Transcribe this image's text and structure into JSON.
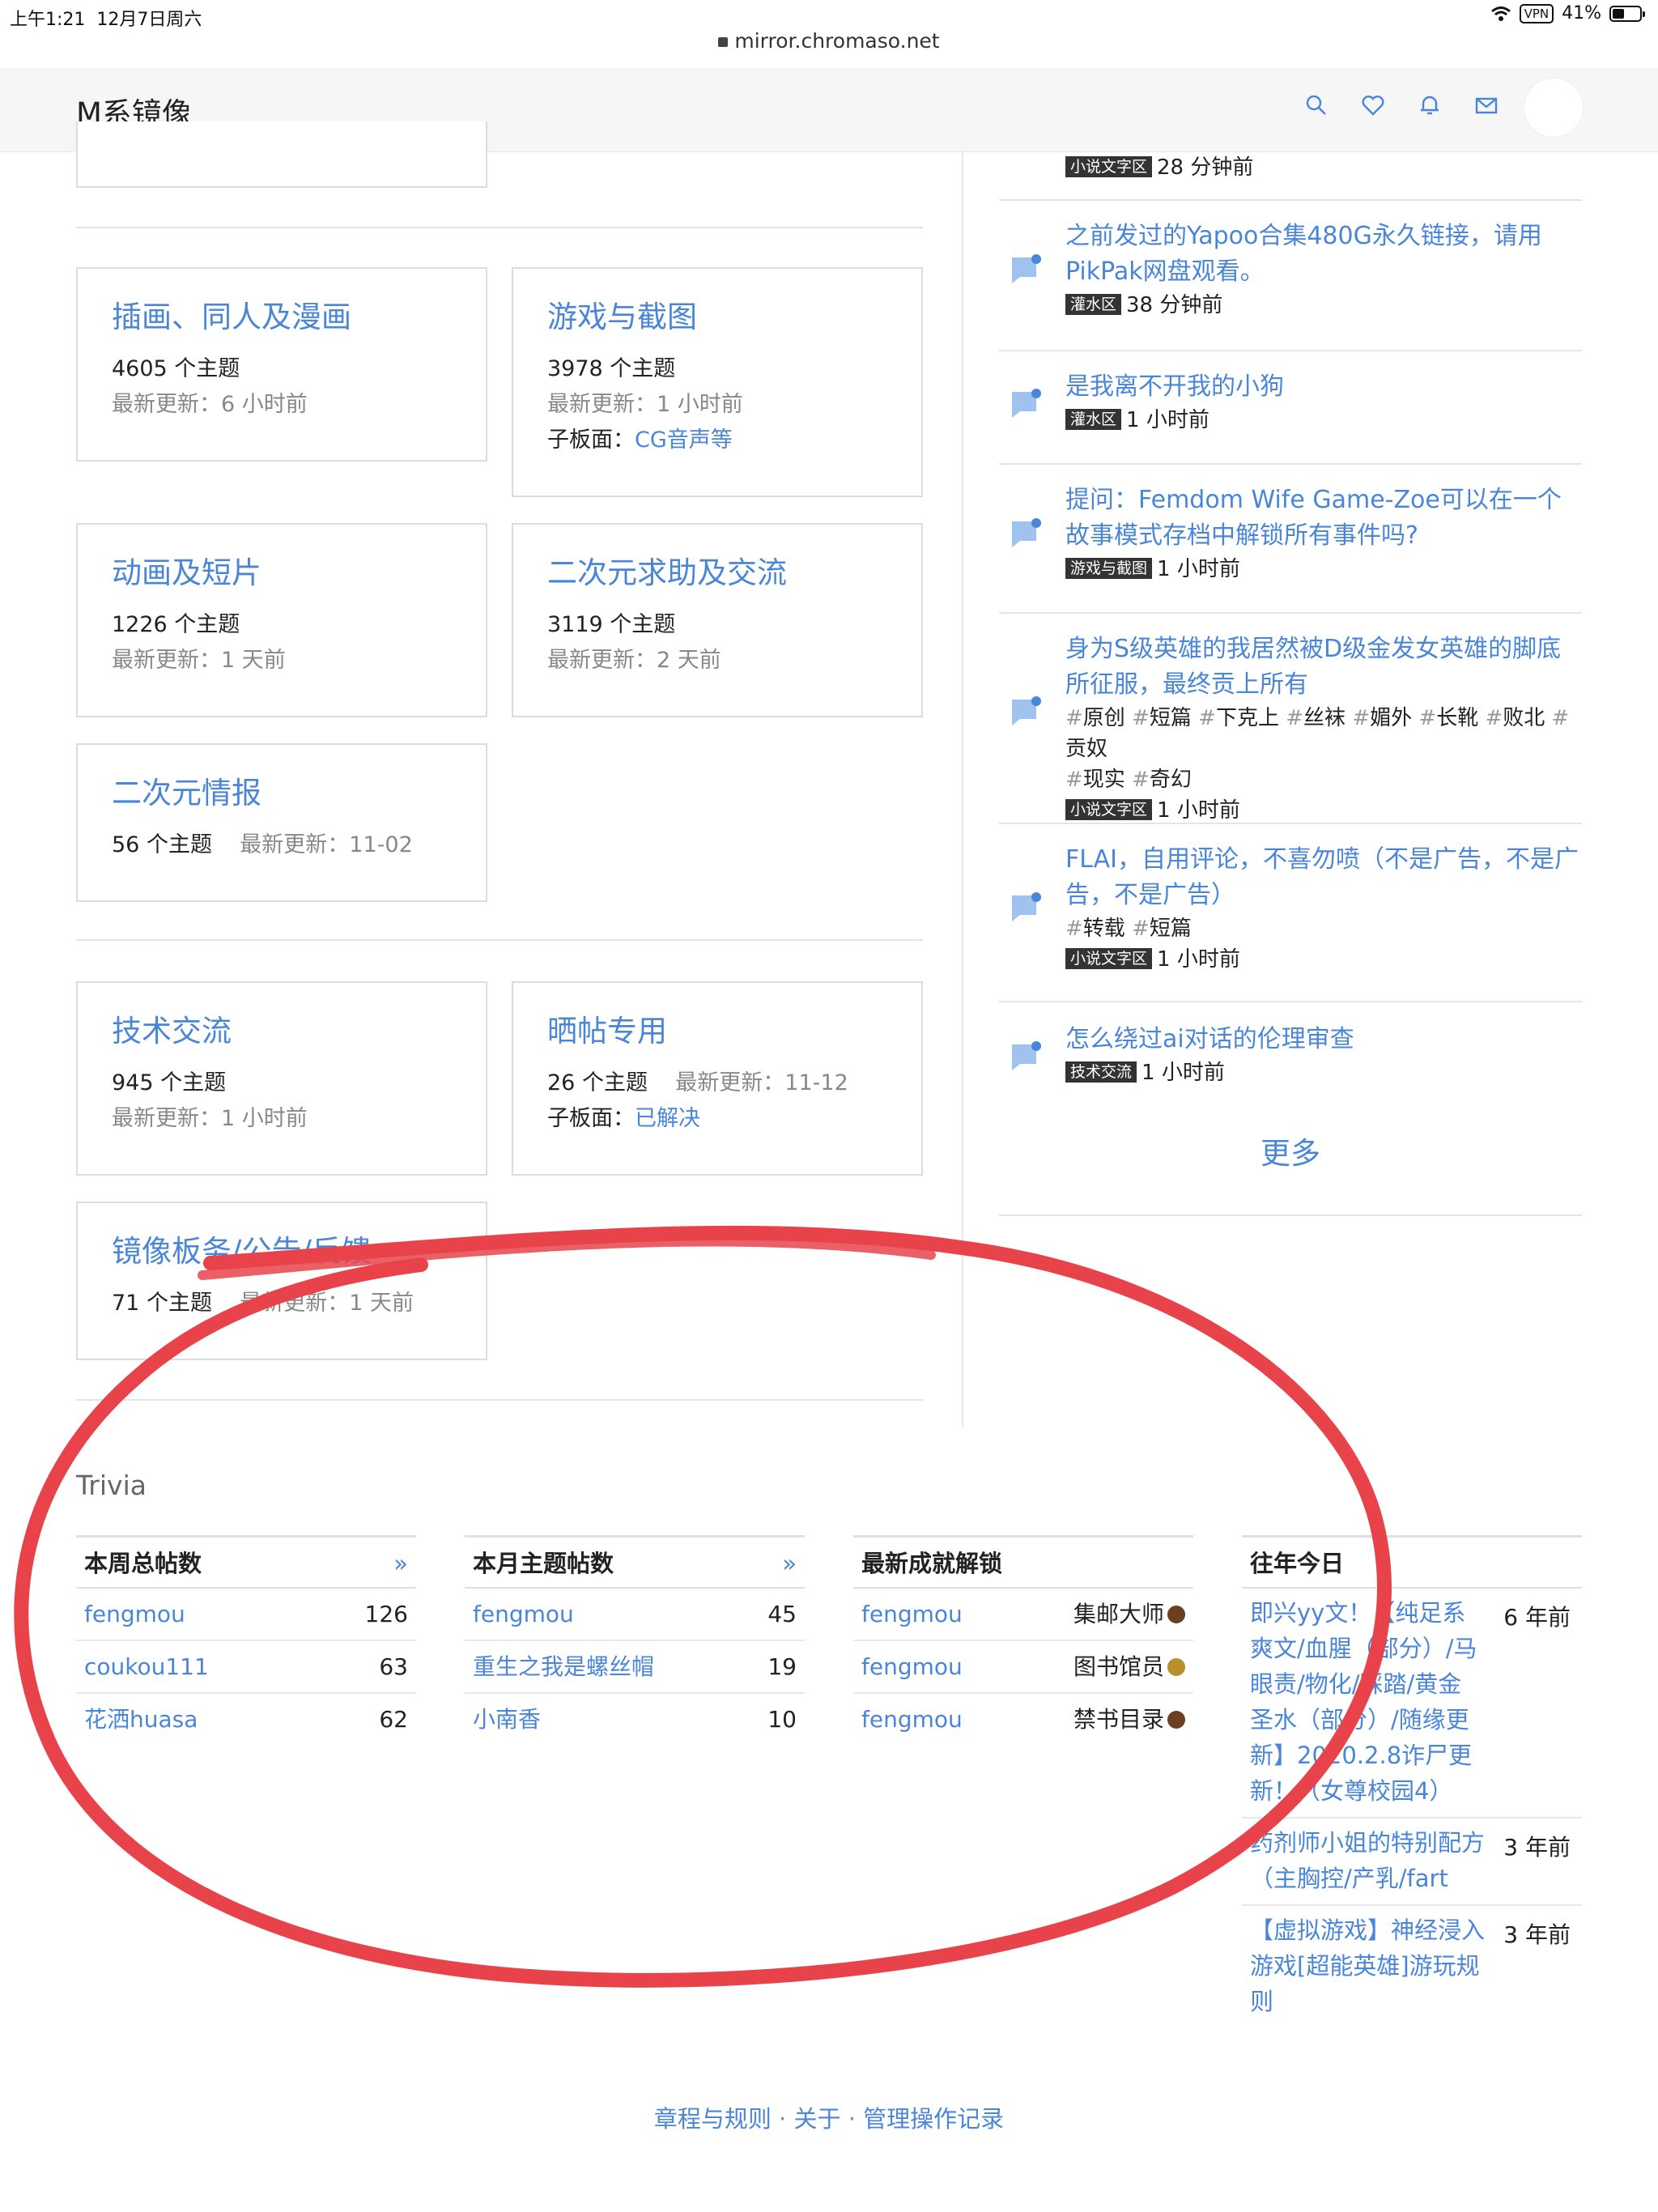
{
  "status": {
    "time": "上午1:21",
    "date": "12月7日周六",
    "vpn": "VPN",
    "battery": "41%"
  },
  "url": "mirror.chromaso.net",
  "nav": {
    "brand": "M系镜像"
  },
  "forums": [
    {
      "title": "插画、同人及漫画",
      "topics": "4605 个主题",
      "updated_label": "最新更新：",
      "updated": "6 小时前"
    },
    {
      "title": "游戏与截图",
      "topics": "3978 个主题",
      "updated_label": "最新更新：",
      "updated": "1 小时前",
      "sub_label": "子板面：",
      "sub": "CG音声等"
    },
    {
      "title": "动画及短片",
      "topics": "1226 个主题",
      "updated_label": "最新更新：",
      "updated": "1 天前"
    },
    {
      "title": "二次元求助及交流",
      "topics": "3119 个主题",
      "updated_label": "最新更新：",
      "updated": "2 天前"
    },
    {
      "title": "二次元情报",
      "topics": "56 个主题",
      "updated_label": "最新更新：",
      "updated": "11-02"
    },
    {
      "title": "技术交流",
      "topics": "945 个主题",
      "updated_label": "最新更新：",
      "updated": "1 小时前"
    },
    {
      "title": "晒帖专用",
      "topics": "26 个主题",
      "updated_label": "最新更新：",
      "updated": "11-12",
      "sub_label": "子板面：",
      "sub": "已解决"
    },
    {
      "title": "镜像板务/公告/反馈",
      "topics": "71 个主题",
      "updated_label": "最新更新：",
      "updated": "1 天前"
    }
  ],
  "posts": [
    {
      "badge": "小说文字区",
      "time": "28 分钟前"
    },
    {
      "title": "之前发过的Yapoo合集480G永久链接，请用PikPak网盘观看。",
      "badge": "灌水区",
      "time": "38 分钟前"
    },
    {
      "title": "是我离不开我的小狗",
      "badge": "灌水区",
      "time": "1 小时前"
    },
    {
      "title": "提问：Femdom Wife Game-Zoe可以在一个故事模式存档中解锁所有事件吗?",
      "badge": "游戏与截图",
      "time": "1 小时前"
    },
    {
      "title": "身为S级英雄的我居然被D级金发女英雄的脚底所征服，最终贡上所有",
      "tags": [
        "原创",
        "短篇",
        "下克上",
        "丝袜",
        "媚外",
        "长靴",
        "败北",
        "贡奴",
        "现实",
        "奇幻"
      ],
      "badge": "小说文字区",
      "time": "1 小时前"
    },
    {
      "title": "FLAI，自用评论，不喜勿喷（不是广告，不是广告，不是广告）",
      "tags": [
        "转载",
        "短篇"
      ],
      "badge": "小说文字区",
      "time": "1 小时前"
    },
    {
      "title": "怎么绕过ai对话的伦理审查",
      "badge": "技术交流",
      "time": "1 小时前"
    }
  ],
  "more": "更多",
  "trivia": {
    "title": "Trivia",
    "weekly": {
      "header": "本周总帖数",
      "more": "»",
      "rows": [
        {
          "name": "fengmou",
          "value": "126"
        },
        {
          "name": "coukou111",
          "value": "63"
        },
        {
          "name": "花洒huasa",
          "value": "62"
        }
      ]
    },
    "monthly": {
      "header": "本月主题帖数",
      "more": "»",
      "rows": [
        {
          "name": "fengmou",
          "value": "45"
        },
        {
          "name": "重生之我是螺丝帽",
          "value": "19"
        },
        {
          "name": "小南香",
          "value": "10"
        }
      ]
    },
    "achievements": {
      "header": "最新成就解锁",
      "rows": [
        {
          "name": "fengmou",
          "value": "集邮大师",
          "color": "#6b3f1f"
        },
        {
          "name": "fengmou",
          "value": "图书馆员",
          "color": "#b8902c"
        },
        {
          "name": "fengmou",
          "value": "禁书目录",
          "color": "#6b3f1f"
        }
      ]
    },
    "history": {
      "header": "往年今日",
      "rows": [
        {
          "title": "即兴yy文！【纯足系爽文/血腥（部分）/马眼责/物化/踩踏/黄金圣水（部分）/随缘更新】2020.2.8诈尸更新！（女尊校园4）",
          "ago": "6 年前"
        },
        {
          "title": "药剂师小姐的特别配方（主胸控/产乳/fart",
          "ago": "3 年前"
        },
        {
          "title": "【虚拟游戏】神经浸入游戏[超能英雄]游玩规则",
          "ago": "3 年前"
        }
      ]
    }
  },
  "footer": {
    "rules": "章程与规则",
    "about": "关于",
    "modlog": "管理操作记录",
    "sep": "·"
  },
  "colors": {
    "accent": "#4a86d8",
    "annotation": "#e8434b"
  }
}
